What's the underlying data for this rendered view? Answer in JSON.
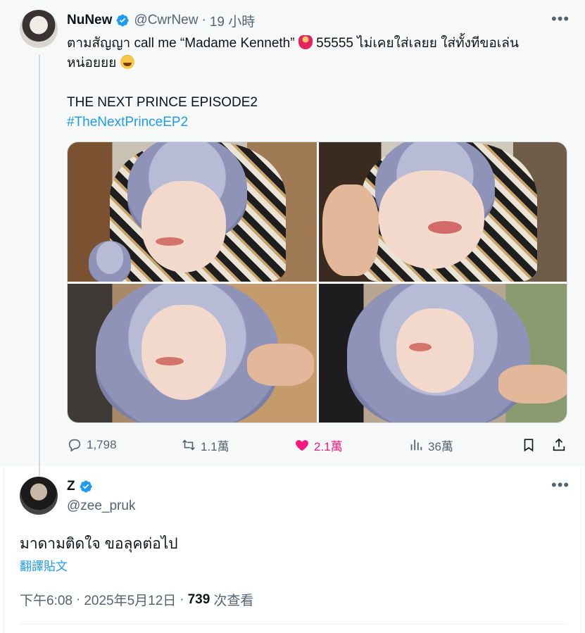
{
  "quoted_tweet": {
    "author_name": "NuNew",
    "author_handle": "@CwrNew",
    "time_ago": "19 小時",
    "text_line1_a": "ตามสัญญา call me “Madame Kenneth” ",
    "text_line1_b": " 55555 ไม่เคยใส่เลยย ใส่ทั้งทีขอเล่น",
    "text_line2": "หน่อยยย ",
    "text_line3": "THE NEXT PRINCE EPISODE2",
    "hashtag": "#TheNextPrinceEP2",
    "metrics": {
      "replies": "1,798",
      "reposts": "1.1萬",
      "likes": "2.1萬",
      "views": "36萬"
    }
  },
  "reply": {
    "author_name": "Z",
    "author_handle": "@zee_pruk",
    "text": "มาดามติดใจ ขอลุคต่อไป",
    "translate_label": "翻譯貼文",
    "time": "下午6:08",
    "date": "2025年5月12日",
    "views_count": "739",
    "views_label": "次查看"
  },
  "icons": [
    "verified-badge-icon",
    "more-icon",
    "reply-icon",
    "repost-icon",
    "like-icon",
    "views-icon",
    "bookmark-icon",
    "share-icon"
  ],
  "colors": {
    "accent": "#1d9bf0",
    "like": "#f91880",
    "muted": "#536471",
    "text": "#0f1419"
  }
}
